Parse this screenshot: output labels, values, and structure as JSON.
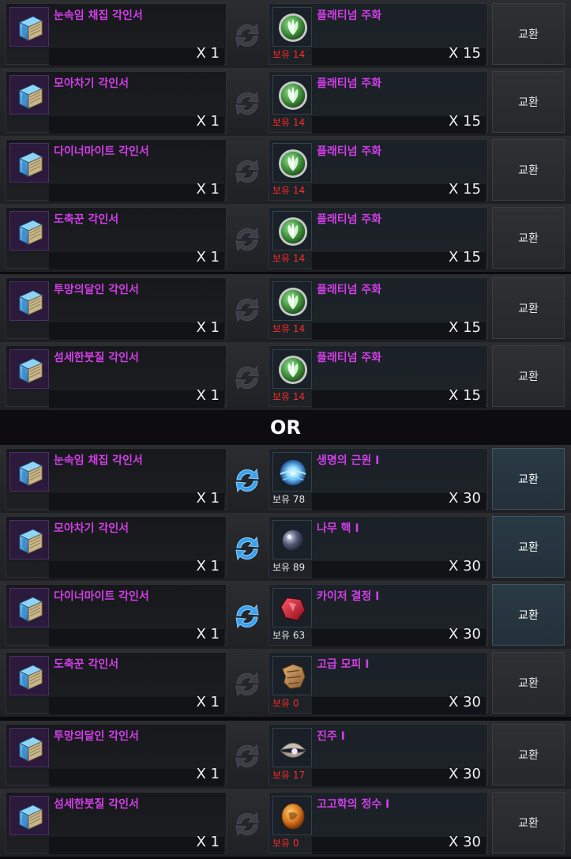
{
  "divider": {
    "label": "OR"
  },
  "exchange_button_label": "교환",
  "platinum_group": [
    {
      "give_name": "눈속임 채집 각인서",
      "give_qty": "X 1",
      "get_name": "플래티넘 주화",
      "get_owned": "보유 14",
      "get_qty": "X 15",
      "icon": "platinum-coin-icon",
      "arrow_active": false,
      "button_active": false
    },
    {
      "give_name": "모아차기 각인서",
      "give_qty": "X 1",
      "get_name": "플래티넘 주화",
      "get_owned": "보유 14",
      "get_qty": "X 15",
      "icon": "platinum-coin-icon",
      "arrow_active": false,
      "button_active": false
    },
    {
      "give_name": "다이너마이트 각인서",
      "give_qty": "X 1",
      "get_name": "플래티넘 주화",
      "get_owned": "보유 14",
      "get_qty": "X 15",
      "icon": "platinum-coin-icon",
      "arrow_active": false,
      "button_active": false
    },
    {
      "give_name": "도축꾼 각인서",
      "give_qty": "X 1",
      "get_name": "플래티넘 주화",
      "get_owned": "보유 14",
      "get_qty": "X 15",
      "icon": "platinum-coin-icon",
      "arrow_active": false,
      "button_active": false
    },
    {
      "give_name": "투망의달인 각인서",
      "give_qty": "X 1",
      "get_name": "플래티넘 주화",
      "get_owned": "보유 14",
      "get_qty": "X 15",
      "icon": "platinum-coin-icon",
      "arrow_active": false,
      "button_active": false
    },
    {
      "give_name": "섬세한붓질 각인서",
      "give_qty": "X 1",
      "get_name": "플래티넘 주화",
      "get_owned": "보유 14",
      "get_qty": "X 15",
      "icon": "platinum-coin-icon",
      "arrow_active": false,
      "button_active": false
    }
  ],
  "material_group": [
    {
      "give_name": "눈속임 채집 각인서",
      "give_qty": "X 1",
      "get_name": "생명의 근원 Ⅰ",
      "get_owned": "보유 78",
      "get_qty": "X 30",
      "icon": "life-essence-icon",
      "arrow_active": true,
      "button_active": true,
      "owned_ok": true
    },
    {
      "give_name": "모아차기 각인서",
      "give_qty": "X 1",
      "get_name": "나무 핵 Ⅰ",
      "get_owned": "보유 89",
      "get_qty": "X 30",
      "icon": "wood-core-icon",
      "arrow_active": true,
      "button_active": true,
      "owned_ok": true
    },
    {
      "give_name": "다이너마이트 각인서",
      "give_qty": "X 1",
      "get_name": "카이저 결정 Ⅰ",
      "get_owned": "보유 63",
      "get_qty": "X 30",
      "icon": "kaiser-crystal-icon",
      "arrow_active": true,
      "button_active": true,
      "owned_ok": true
    },
    {
      "give_name": "도축꾼 각인서",
      "give_qty": "X 1",
      "get_name": "고급 모피 Ⅰ",
      "get_owned": "보유 0",
      "get_qty": "X 30",
      "icon": "fur-icon",
      "arrow_active": false,
      "button_active": false,
      "owned_ok": false
    },
    {
      "give_name": "투망의달인 각인서",
      "give_qty": "X 1",
      "get_name": "진주 Ⅰ",
      "get_owned": "보유 17",
      "get_qty": "X 30",
      "icon": "pearl-icon",
      "arrow_active": false,
      "button_active": false,
      "owned_ok": false
    },
    {
      "give_name": "섬세한붓질 각인서",
      "give_qty": "X 1",
      "get_name": "고고학의 정수 Ⅰ",
      "get_owned": "보유 0",
      "get_qty": "X 30",
      "icon": "archaeology-essence-icon",
      "arrow_active": false,
      "button_active": false,
      "owned_ok": false
    }
  ],
  "colors": {
    "item_name": "#d23ee8",
    "owned_zero": "#ff2a2a",
    "owned_ok": "#e8e8e8",
    "arrow_active": "#3aa0f0",
    "arrow_inactive": "#3a3d42"
  }
}
